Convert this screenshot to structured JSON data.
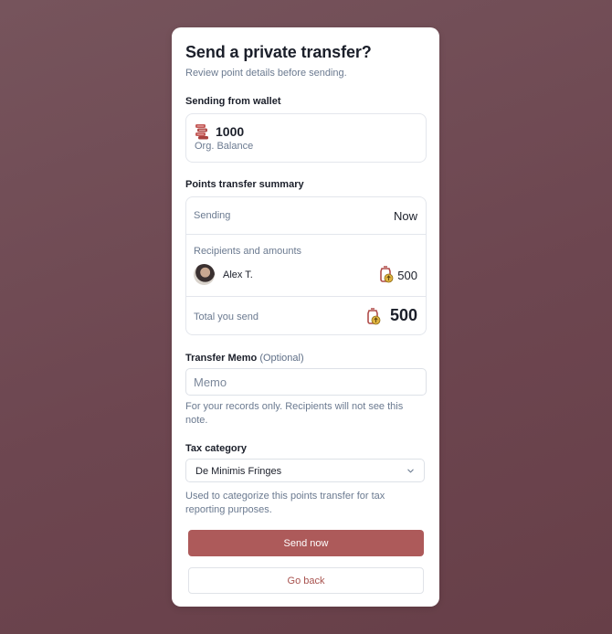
{
  "dialog": {
    "title": "Send a private transfer?",
    "subtitle": "Review point details before sending."
  },
  "wallet": {
    "label": "Sending from wallet",
    "amount": "1000",
    "name": "Org. Balance",
    "icon": "coin-stack-icon"
  },
  "summary": {
    "label": "Points transfer summary",
    "sending_label": "Sending",
    "sending_value": "Now",
    "recipients_label": "Recipients and amounts",
    "recipients": [
      {
        "name": "Alex T.",
        "amount": "500"
      }
    ],
    "total_label": "Total you send",
    "total_value": "500",
    "points_icon": "points-bag-icon"
  },
  "memo": {
    "label": "Transfer Memo",
    "optional": "(Optional)",
    "placeholder": "Memo",
    "value": "",
    "help": "For your records only. Recipients will not see this note."
  },
  "tax": {
    "label": "Tax category",
    "selected": "De Minimis Fringes",
    "help": "Used to categorize this points transfer for tax reporting purposes."
  },
  "actions": {
    "primary": "Send now",
    "secondary": "Go back"
  },
  "colors": {
    "accent": "#ad5a5a",
    "backdrop": "#6d4650",
    "link": "#a8534f"
  }
}
